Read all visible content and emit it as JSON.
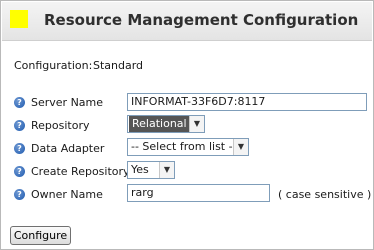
{
  "header": {
    "title": "Resource Management Configuration",
    "icon_color": "#ffff00"
  },
  "configuration": {
    "label": "Configuration:",
    "value": "Standard"
  },
  "form": {
    "server_name": {
      "label": "Server Name",
      "value": "INFORMAT-33F6D7:8117"
    },
    "repository": {
      "label": "Repository",
      "value": "Relational"
    },
    "data_adapter": {
      "label": "Data Adapter",
      "value": "-- Select from list --"
    },
    "create_repository": {
      "label": "Create Repository",
      "value": "Yes"
    },
    "owner_name": {
      "label": "Owner Name",
      "value": "rarg",
      "hint": "( case sensitive )"
    }
  },
  "help_icon": "?",
  "actions": {
    "configure_label": "Configure"
  }
}
